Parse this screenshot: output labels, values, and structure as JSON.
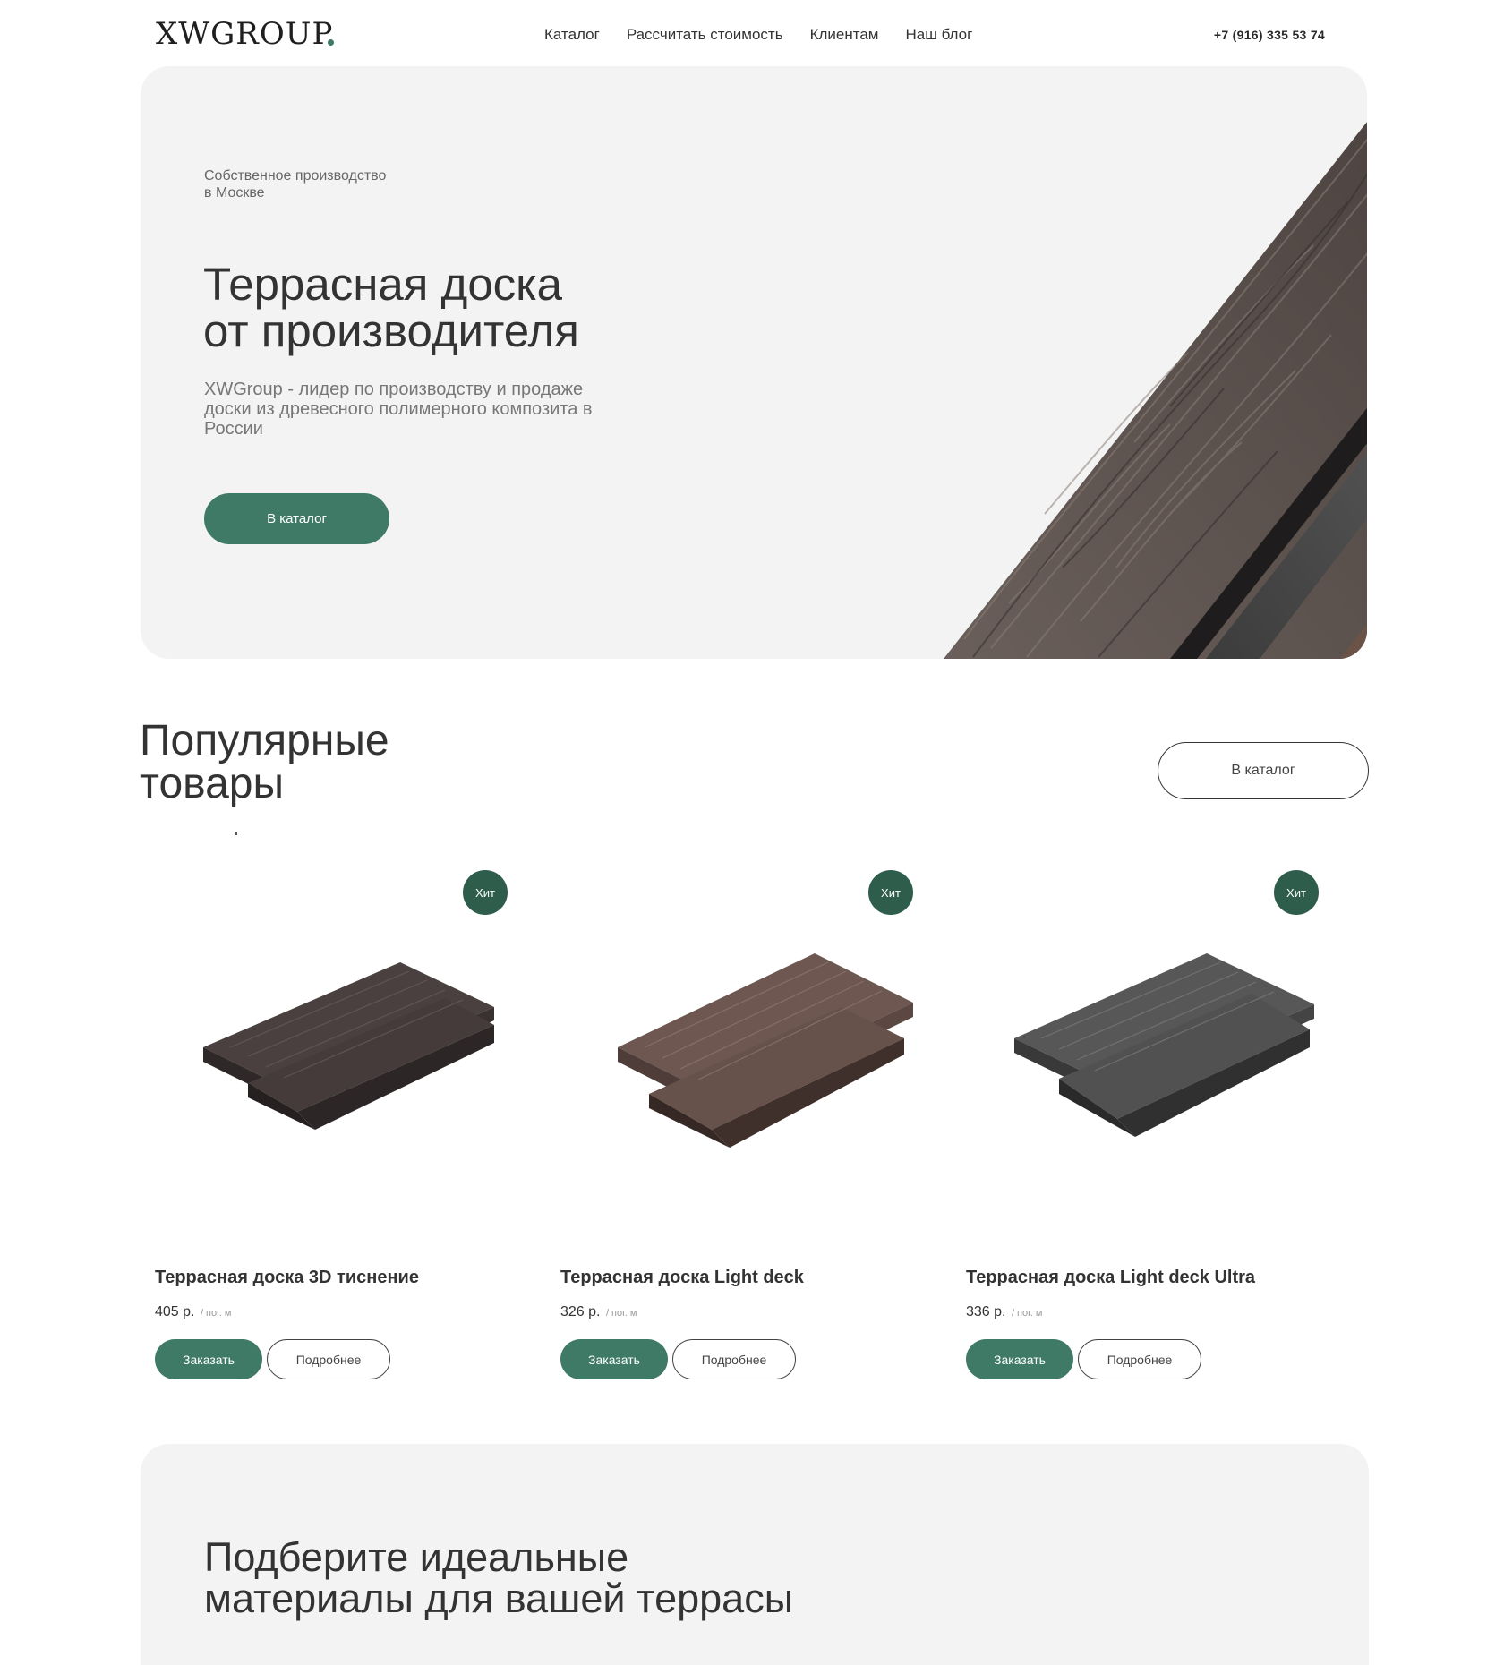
{
  "header": {
    "logo": "XWGROUP",
    "nav": [
      "Каталог",
      "Рассчитать стоимость",
      "Клиентам",
      "Наш блог"
    ],
    "phone": "+7 (916) 335 53 74"
  },
  "hero": {
    "eyebrow_line1": "Собственное производство",
    "eyebrow_line2": "в Москве",
    "title_line1": "Террасная доска",
    "title_line2": "от производителя",
    "subtitle": "XWGroup - лидер по производству и продаже доски из древесного полимерного композита в России",
    "button": "В каталог"
  },
  "popular": {
    "title_line1": "Популярные",
    "title_line2": "товары",
    "catalog_button": "В каталог",
    "products": [
      {
        "badge": "Хит",
        "name": "Террасная доска 3D тиснение",
        "price": "405 р.",
        "unit": "/ пог. м",
        "order": "Заказать",
        "more": "Подробнее",
        "color": "#4a4040"
      },
      {
        "badge": "Хит",
        "name": "Террасная доска Light deck",
        "price": "326 р.",
        "unit": "/ пог. м",
        "order": "Заказать",
        "more": "Подробнее",
        "color": "#6d5750"
      },
      {
        "badge": "Хит",
        "name": "Террасная доска Light deck Ultra",
        "price": "336 р.",
        "unit": "/ пог. м",
        "order": "Заказать",
        "more": "Подробнее",
        "color": "#575757"
      }
    ]
  },
  "bottom": {
    "title_line1": "Подберите идеальные",
    "title_line2": "материалы для вашей террасы"
  },
  "colors": {
    "accent": "#3f7a66",
    "badge": "#2e5d4c",
    "panel": "#f3f3f3"
  }
}
